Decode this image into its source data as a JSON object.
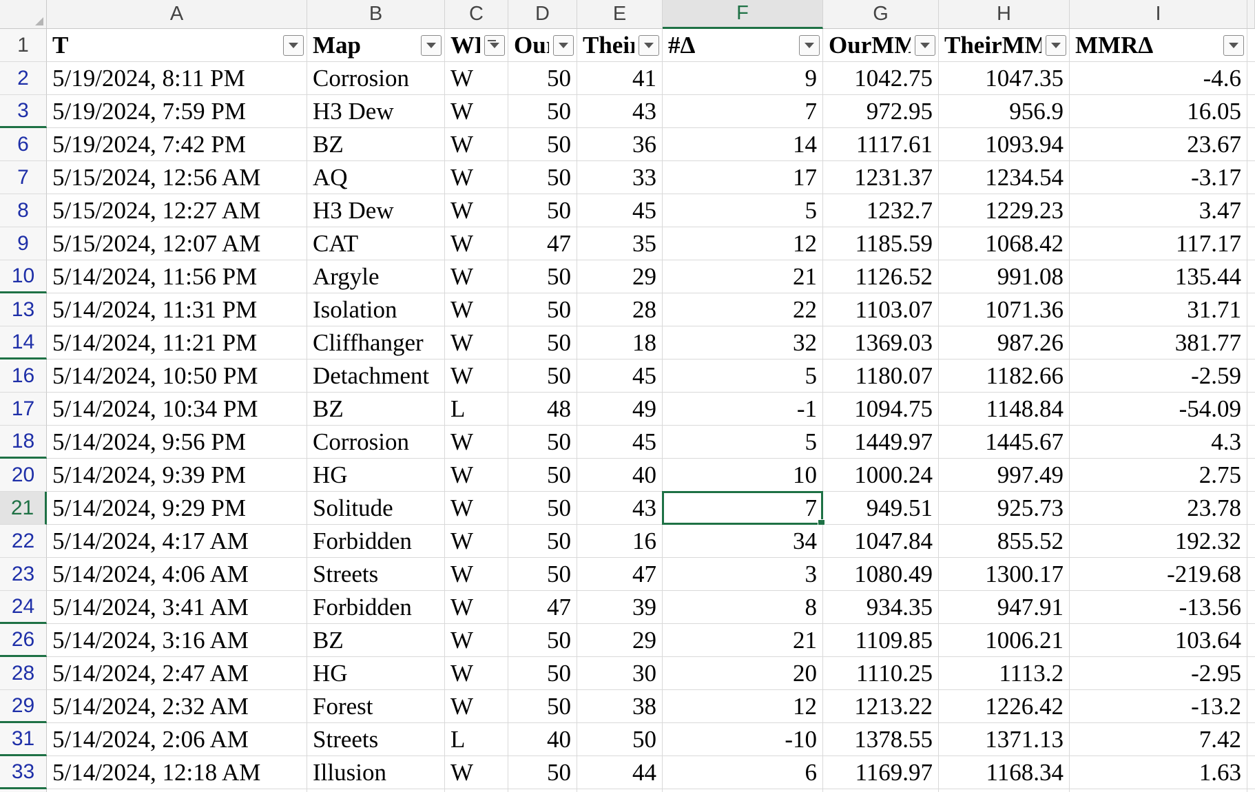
{
  "columns": [
    "A",
    "B",
    "C",
    "D",
    "E",
    "F",
    "G",
    "H",
    "I"
  ],
  "header_row_number": "1",
  "headers": [
    "T",
    "Map",
    "WL",
    "Our",
    "Their",
    "#Δ",
    "OurMMR",
    "TheirMMR",
    "MMRΔ"
  ],
  "next_column_partial": "I",
  "selected_column": "F",
  "selected_row": "21",
  "rows": [
    {
      "row": "2",
      "t": "5/19/2024, 8:11 PM",
      "map": "Corrosion",
      "wl": "W",
      "our": "50",
      "their": "41",
      "delta": "9",
      "ourmmr": "1042.75",
      "theirmmr": "1047.35",
      "mmrdelta": "-4.6"
    },
    {
      "row": "3",
      "t": "5/19/2024, 7:59 PM",
      "map": "H3 Dew",
      "wl": "W",
      "our": "50",
      "their": "43",
      "delta": "7",
      "ourmmr": "972.95",
      "theirmmr": "956.9",
      "mmrdelta": "16.05"
    },
    {
      "row": "6",
      "t": "5/19/2024, 7:42 PM",
      "map": "BZ",
      "wl": "W",
      "our": "50",
      "their": "36",
      "delta": "14",
      "ourmmr": "1117.61",
      "theirmmr": "1093.94",
      "mmrdelta": "23.67"
    },
    {
      "row": "7",
      "t": "5/15/2024, 12:56 AM",
      "map": "AQ",
      "wl": "W",
      "our": "50",
      "their": "33",
      "delta": "17",
      "ourmmr": "1231.37",
      "theirmmr": "1234.54",
      "mmrdelta": "-3.17"
    },
    {
      "row": "8",
      "t": "5/15/2024, 12:27 AM",
      "map": "H3 Dew",
      "wl": "W",
      "our": "50",
      "their": "45",
      "delta": "5",
      "ourmmr": "1232.7",
      "theirmmr": "1229.23",
      "mmrdelta": "3.47"
    },
    {
      "row": "9",
      "t": "5/15/2024, 12:07 AM",
      "map": "CAT",
      "wl": "W",
      "our": "47",
      "their": "35",
      "delta": "12",
      "ourmmr": "1185.59",
      "theirmmr": "1068.42",
      "mmrdelta": "117.17"
    },
    {
      "row": "10",
      "t": "5/14/2024, 11:56 PM",
      "map": "Argyle",
      "wl": "W",
      "our": "50",
      "their": "29",
      "delta": "21",
      "ourmmr": "1126.52",
      "theirmmr": "991.08",
      "mmrdelta": "135.44"
    },
    {
      "row": "13",
      "t": "5/14/2024, 11:31 PM",
      "map": "Isolation",
      "wl": "W",
      "our": "50",
      "their": "28",
      "delta": "22",
      "ourmmr": "1103.07",
      "theirmmr": "1071.36",
      "mmrdelta": "31.71"
    },
    {
      "row": "14",
      "t": "5/14/2024, 11:21 PM",
      "map": "Cliffhanger",
      "wl": "W",
      "our": "50",
      "their": "18",
      "delta": "32",
      "ourmmr": "1369.03",
      "theirmmr": "987.26",
      "mmrdelta": "381.77"
    },
    {
      "row": "16",
      "t": "5/14/2024, 10:50 PM",
      "map": "Detachment",
      "wl": "W",
      "our": "50",
      "their": "45",
      "delta": "5",
      "ourmmr": "1180.07",
      "theirmmr": "1182.66",
      "mmrdelta": "-2.59"
    },
    {
      "row": "17",
      "t": "5/14/2024, 10:34 PM",
      "map": "BZ",
      "wl": "L",
      "our": "48",
      "their": "49",
      "delta": "-1",
      "ourmmr": "1094.75",
      "theirmmr": "1148.84",
      "mmrdelta": "-54.09"
    },
    {
      "row": "18",
      "t": "5/14/2024, 9:56 PM",
      "map": "Corrosion",
      "wl": "W",
      "our": "50",
      "their": "45",
      "delta": "5",
      "ourmmr": "1449.97",
      "theirmmr": "1445.67",
      "mmrdelta": "4.3"
    },
    {
      "row": "20",
      "t": "5/14/2024, 9:39 PM",
      "map": "HG",
      "wl": "W",
      "our": "50",
      "their": "40",
      "delta": "10",
      "ourmmr": "1000.24",
      "theirmmr": "997.49",
      "mmrdelta": "2.75"
    },
    {
      "row": "21",
      "t": "5/14/2024, 9:29 PM",
      "map": "Solitude",
      "wl": "W",
      "our": "50",
      "their": "43",
      "delta": "7",
      "ourmmr": "949.51",
      "theirmmr": "925.73",
      "mmrdelta": "23.78"
    },
    {
      "row": "22",
      "t": "5/14/2024, 4:17 AM",
      "map": "Forbidden",
      "wl": "W",
      "our": "50",
      "their": "16",
      "delta": "34",
      "ourmmr": "1047.84",
      "theirmmr": "855.52",
      "mmrdelta": "192.32"
    },
    {
      "row": "23",
      "t": "5/14/2024, 4:06 AM",
      "map": "Streets",
      "wl": "W",
      "our": "50",
      "their": "47",
      "delta": "3",
      "ourmmr": "1080.49",
      "theirmmr": "1300.17",
      "mmrdelta": "-219.68"
    },
    {
      "row": "24",
      "t": "5/14/2024, 3:41 AM",
      "map": "Forbidden",
      "wl": "W",
      "our": "47",
      "their": "39",
      "delta": "8",
      "ourmmr": "934.35",
      "theirmmr": "947.91",
      "mmrdelta": "-13.56"
    },
    {
      "row": "26",
      "t": "5/14/2024, 3:16 AM",
      "map": "BZ",
      "wl": "W",
      "our": "50",
      "their": "29",
      "delta": "21",
      "ourmmr": "1109.85",
      "theirmmr": "1006.21",
      "mmrdelta": "103.64"
    },
    {
      "row": "28",
      "t": "5/14/2024, 2:47 AM",
      "map": "HG",
      "wl": "W",
      "our": "50",
      "their": "30",
      "delta": "20",
      "ourmmr": "1110.25",
      "theirmmr": "1113.2",
      "mmrdelta": "-2.95"
    },
    {
      "row": "29",
      "t": "5/14/2024, 2:32 AM",
      "map": "Forest",
      "wl": "W",
      "our": "50",
      "their": "38",
      "delta": "12",
      "ourmmr": "1213.22",
      "theirmmr": "1226.42",
      "mmrdelta": "-13.2"
    },
    {
      "row": "31",
      "t": "5/14/2024, 2:06 AM",
      "map": "Streets",
      "wl": "L",
      "our": "40",
      "their": "50",
      "delta": "-10",
      "ourmmr": "1378.55",
      "theirmmr": "1371.13",
      "mmrdelta": "7.42"
    },
    {
      "row": "33",
      "t": "5/14/2024, 12:18 AM",
      "map": "Illusion",
      "wl": "W",
      "our": "50",
      "their": "44",
      "delta": "6",
      "ourmmr": "1169.97",
      "theirmmr": "1168.34",
      "mmrdelta": "1.63"
    }
  ]
}
